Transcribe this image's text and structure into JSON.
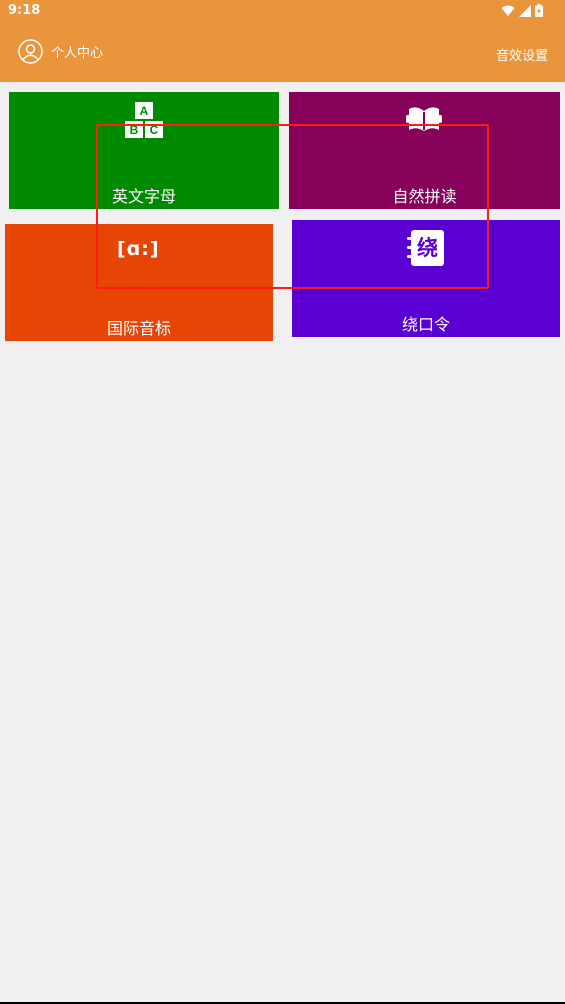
{
  "status_bar": {
    "time": "9:18"
  },
  "header": {
    "profile_label": "个人中心",
    "settings_label": "音效设置"
  },
  "tiles": [
    {
      "label": "英文字母",
      "color": "#008a00",
      "icon": "abc-blocks-icon"
    },
    {
      "label": "自然拼读",
      "color": "#87005a",
      "icon": "open-book-icon"
    },
    {
      "label": "国际音标",
      "color": "#e74505",
      "icon": "phonetic-bracket-icon"
    },
    {
      "label": "绕口令",
      "color": "#5b00d3",
      "icon": "notebook-icon",
      "icon_text": "绕"
    }
  ],
  "icon_letters": {
    "a": "A",
    "b": "B",
    "c": "C"
  },
  "phonetic_symbol": "[ɑ:]",
  "colors": {
    "header": "#ea943c",
    "background": "#f0f0f0",
    "highlight_box": "#ff1a1a"
  }
}
